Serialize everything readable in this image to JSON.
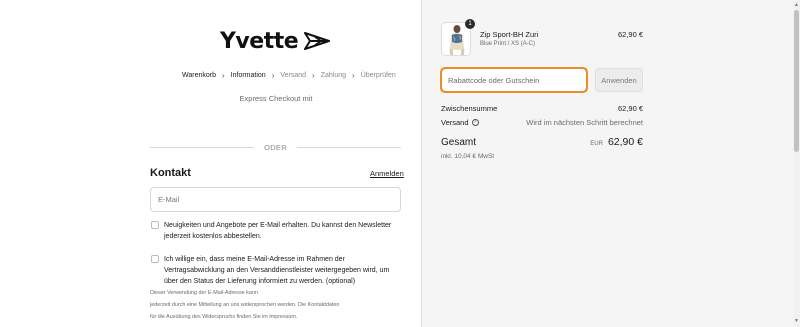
{
  "brand": {
    "name": "Yvette",
    "logo_icon": "paper-plane-icon"
  },
  "breadcrumb": [
    {
      "label": "Warenkorb",
      "state": "done"
    },
    {
      "label": "Information",
      "state": "current"
    },
    {
      "label": "Versand",
      "state": "upcoming"
    },
    {
      "label": "Zahlung",
      "state": "upcoming"
    },
    {
      "label": "Überprüfen",
      "state": "upcoming"
    }
  ],
  "express_checkout": {
    "label": "Express Checkout mit"
  },
  "divider": {
    "label": "ODER"
  },
  "contact": {
    "title": "Kontakt",
    "login_link": "Anmelden",
    "email_placeholder": "E-Mail",
    "newsletter_label": "Neuigkeiten und Angebote per E-Mail erhalten. Du kannst den Newsletter jederzeit kostenlos abbestellen.",
    "consent_label": "Ich willige ein, dass meine E-Mail-Adresse im Rahmen der Vertragsabwicklung an den Versanddienstleister weitergegeben wird, um über den Status der Lieferung informiert zu werden. (optional)",
    "note_lines": [
      "Dieser Verwendung der E-Mail-Adresse kann",
      "jederzeit durch eine Mitteilung an uns widersprochen werden. Die Kontaktdaten",
      "für die Ausübung des Widerspruchs finden Sie im Impressum."
    ]
  },
  "order": {
    "product": {
      "name": "Zip Sport-BH Zuri",
      "variant": "Blue Print / XS (A-C)",
      "price": "62,90 €",
      "quantity": "1"
    },
    "discount": {
      "placeholder": "Rabattcode oder Gutschein",
      "apply_label": "Anwenden"
    },
    "subtotal": {
      "label": "Zwischensumme",
      "value": "62,90 €"
    },
    "shipping": {
      "label": "Versand",
      "value": "Wird im nächsten Schritt berechnet"
    },
    "total": {
      "label": "Gesamt",
      "currency": "EUR",
      "value": "62,90 €"
    },
    "tax_note": "inkl. 10,04 € MwSt"
  },
  "colors": {
    "focus_outline": "#f08a24",
    "sidebar_bg": "#f5f5f5",
    "text": "#1a1a1a",
    "muted": "#6b6b6b"
  }
}
